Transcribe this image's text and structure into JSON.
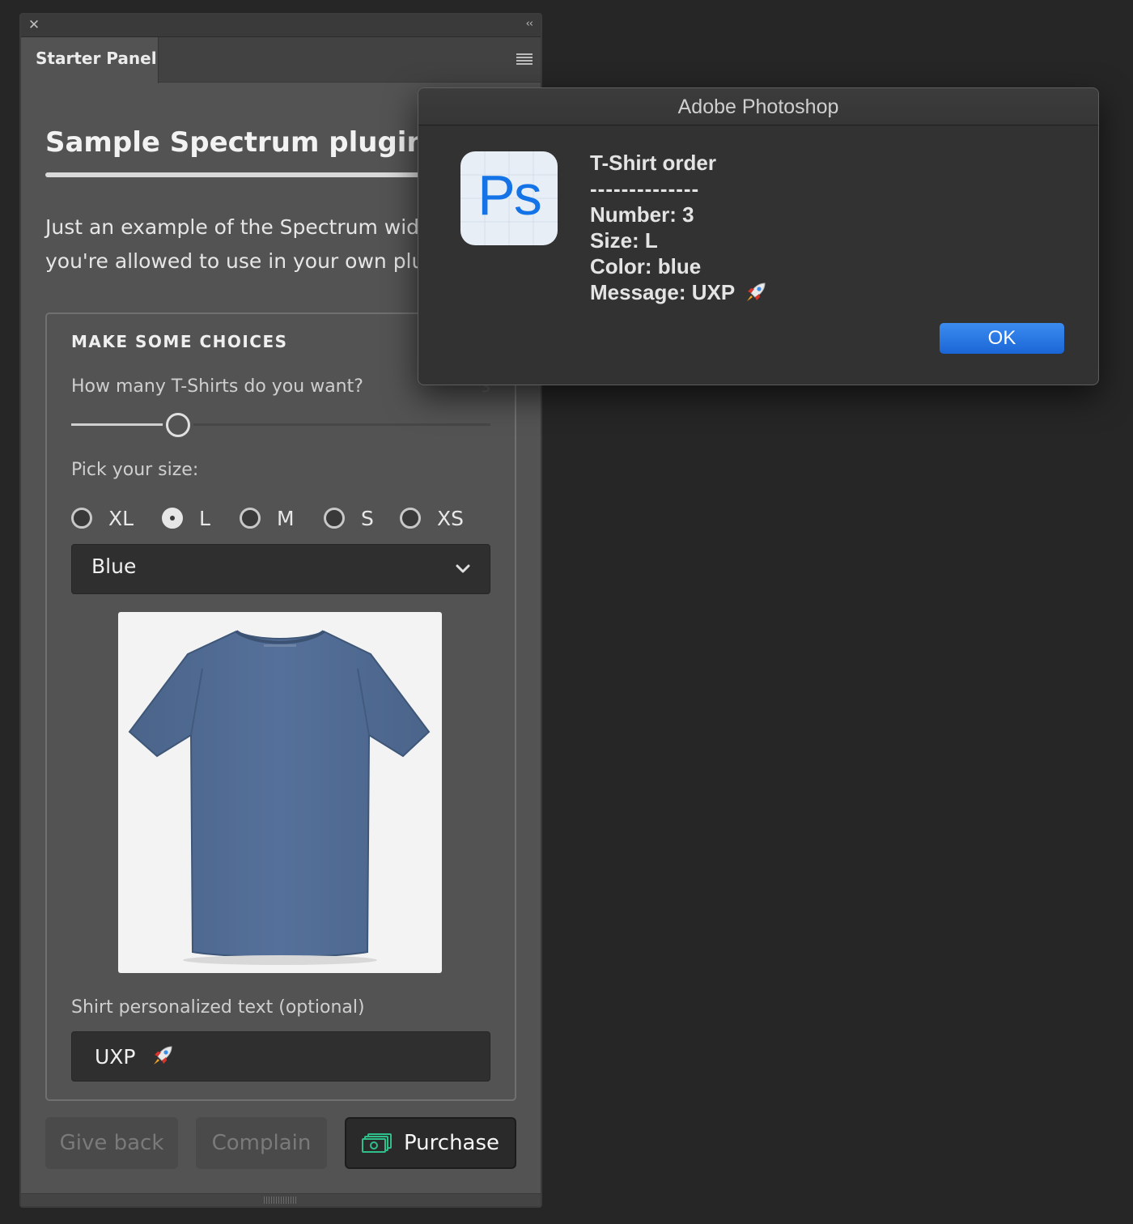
{
  "panel": {
    "tab_label": "Starter Panel",
    "title": "Sample Spectrum plugin",
    "description_line1": "Just an example of the Spectrum widgets",
    "description_line2": "you're allowed to use in your own plugins",
    "choices": {
      "heading": "MAKE SOME CHOICES",
      "slider_label": "How many T-Shirts do you want?",
      "slider_value": "3",
      "slider_fraction": 0.24,
      "size_label": "Pick your size:",
      "sizes": [
        "XL",
        "L",
        "M",
        "S",
        "XS"
      ],
      "selected_size": "L",
      "color_picker_value": "Blue",
      "text_label": "Shirt personalized text (optional)",
      "text_value": "UXP"
    },
    "buttons": {
      "give_back": "Give back",
      "complain": "Complain",
      "purchase": "Purchase"
    }
  },
  "dialog": {
    "title": "Adobe Photoshop",
    "app_icon_label": "Ps",
    "lines": {
      "heading": "T-Shirt order",
      "separator": "--------------",
      "number": "Number: 3",
      "size": "Size: L",
      "color": "Color: blue",
      "message": "Message: UXP"
    },
    "ok_label": "OK"
  },
  "colors": {
    "accent_blue": "#1473e6",
    "shirt_blue": "#4f6a90",
    "purchase_icon_green": "#2fbf8a"
  },
  "icons": [
    "close-icon",
    "collapse-icon",
    "menu-icon",
    "chevron-down-icon",
    "money-icon",
    "rocket-icon",
    "grip-icon"
  ]
}
